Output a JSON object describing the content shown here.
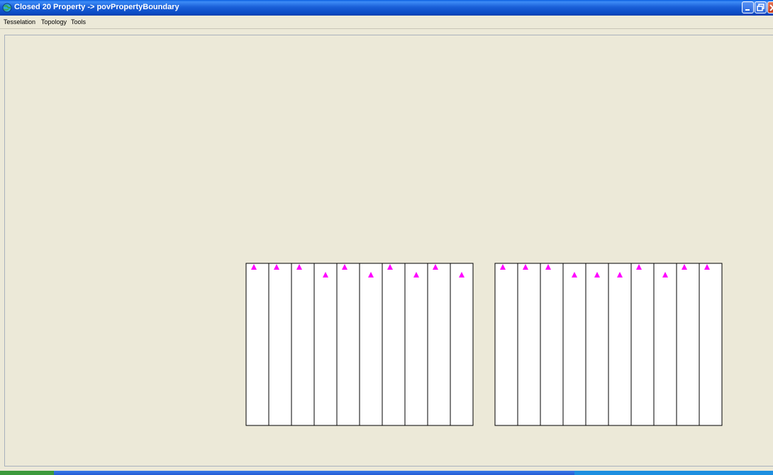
{
  "window": {
    "title": "Closed 20  Property -> povPropertyBoundary"
  },
  "menubar": {
    "items": [
      "Tesselation",
      "Topology",
      "Tools"
    ]
  },
  "colors": {
    "marker": "#ff00ff",
    "lot_fill": "#ffffff",
    "lot_border": "#000000",
    "canvas_bg": "#ece9d8"
  },
  "property_blocks": [
    {
      "name": "left-block",
      "lot_count": 10,
      "markers": [
        "high",
        "high",
        "high",
        "low",
        "high",
        "low",
        "high",
        "low",
        "high",
        "low"
      ]
    },
    {
      "name": "right-block",
      "lot_count": 10,
      "markers": [
        "high",
        "high",
        "high",
        "low",
        "low",
        "low",
        "high",
        "low",
        "high",
        "high"
      ]
    }
  ]
}
